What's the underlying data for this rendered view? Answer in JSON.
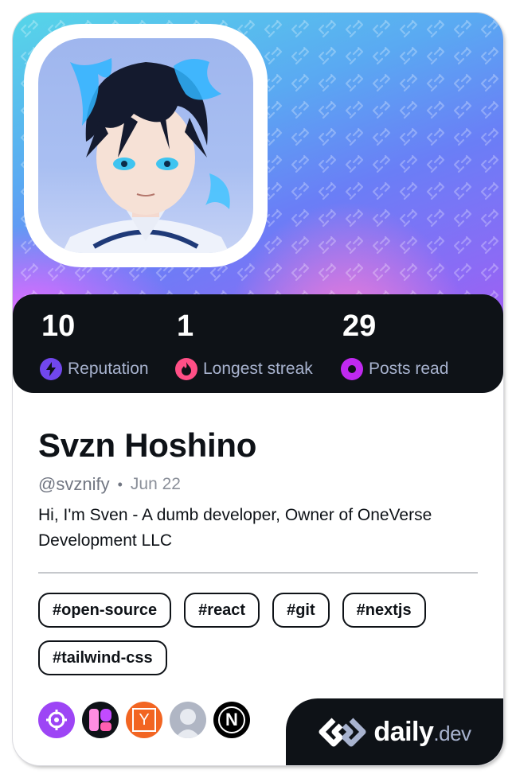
{
  "profile": {
    "name": "Svzn Hoshino",
    "handle": "@svznify",
    "separator": "•",
    "joined": "Jun 22",
    "bio": "Hi, I'm Sven - A dumb developer, Owner of OneVerse Development LLC"
  },
  "stats": [
    {
      "value": "10",
      "label": "Reputation",
      "icon": "lightning-icon",
      "color": "#7147ed"
    },
    {
      "value": "1",
      "label": "Longest streak",
      "icon": "flame-icon",
      "color": "#ff4f86"
    },
    {
      "value": "29",
      "label": "Posts read",
      "icon": "eye-ring-icon",
      "color": "#c029f0"
    }
  ],
  "tags": [
    "#open-source",
    "#react",
    "#git",
    "#nextjs",
    "#tailwind-css"
  ],
  "sources": [
    {
      "icon": "crosshair-icon",
      "color": "#9d45f5"
    },
    {
      "icon": "ui-logo-icon",
      "color": "#0e1217"
    },
    {
      "icon": "y-combinator-icon",
      "color": "#f26522",
      "letter": "Y"
    },
    {
      "icon": "user-placeholder-icon",
      "color": "#b0b6c4"
    },
    {
      "icon": "nextjs-n-icon",
      "color": "#000000",
      "letter": "N"
    }
  ],
  "brand": {
    "name": "daily",
    "suffix": ".dev"
  }
}
